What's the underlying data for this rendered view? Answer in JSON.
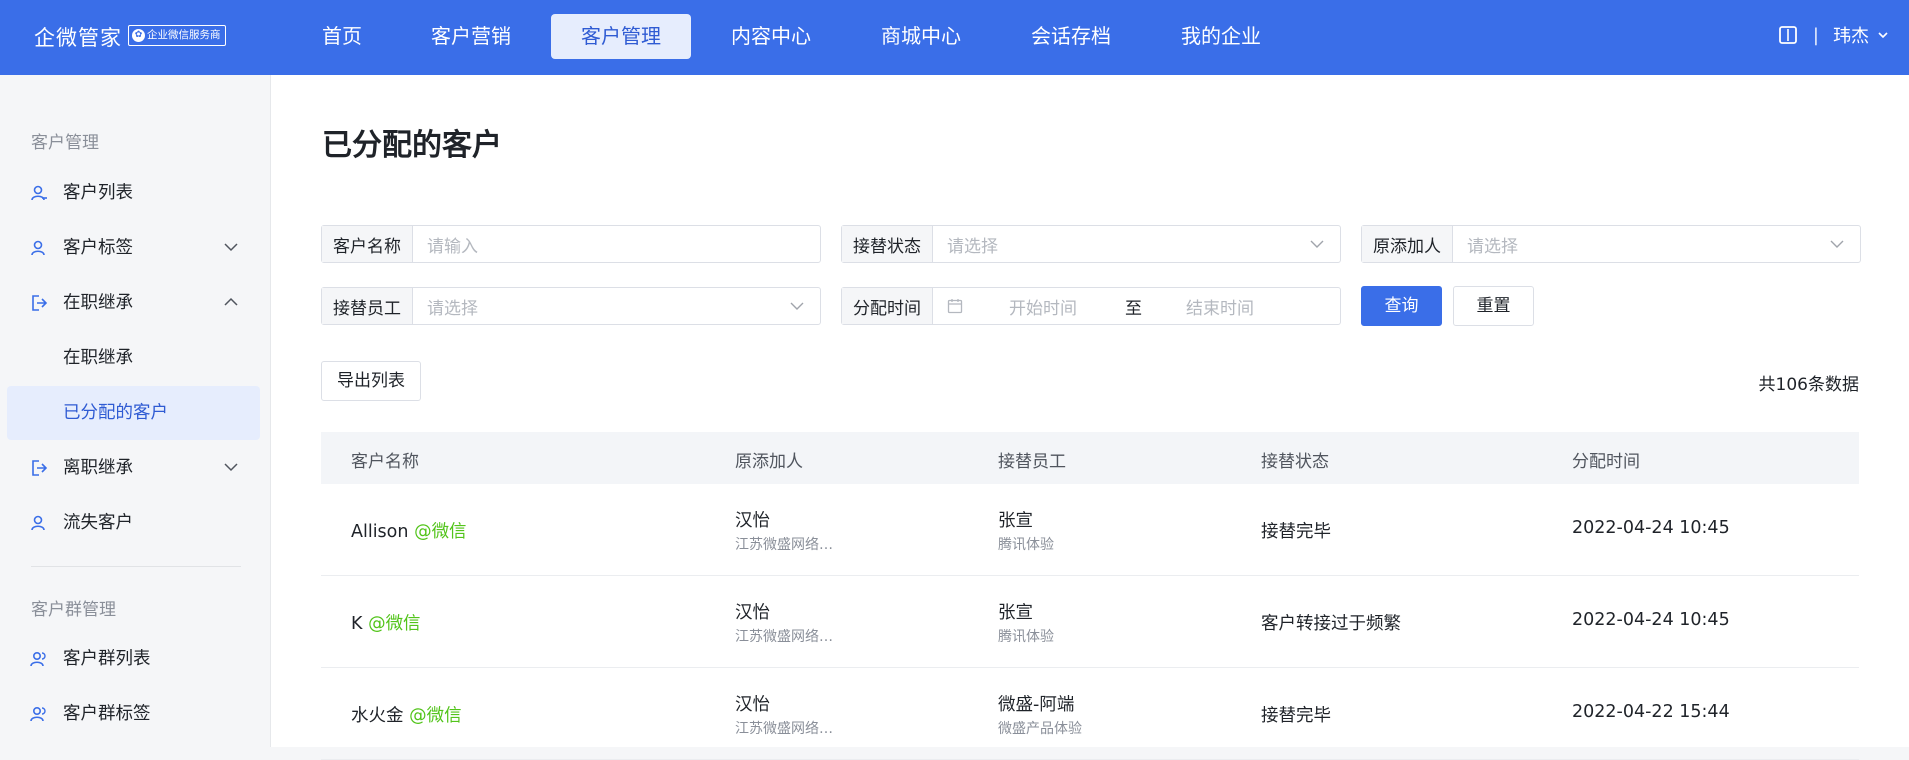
{
  "header": {
    "logo_text": "企微管家",
    "logo_badge": "企业微信服务商",
    "nav": [
      {
        "label": "首页"
      },
      {
        "label": "客户营销"
      },
      {
        "label": "客户管理"
      },
      {
        "label": "内容中心"
      },
      {
        "label": "商城中心"
      },
      {
        "label": "会话存档"
      },
      {
        "label": "我的企业"
      }
    ],
    "active_nav": "客户管理",
    "separator": "|",
    "user_name": "玮杰"
  },
  "sidebar": {
    "group1_title": "客户管理",
    "items": [
      {
        "label": "客户列表",
        "icon": "user-list-icon"
      },
      {
        "label": "客户标签",
        "icon": "user-tag-icon"
      },
      {
        "label": "在职继承",
        "icon": "transfer-in-icon"
      },
      {
        "label": "在职继承"
      },
      {
        "label": "已分配的客户"
      },
      {
        "label": "离职继承",
        "icon": "transfer-out-icon"
      },
      {
        "label": "流失客户",
        "icon": "user-lost-icon"
      }
    ],
    "group2_title": "客户群管理",
    "group2_items": [
      {
        "label": "客户群列表",
        "icon": "group-list-icon"
      },
      {
        "label": "客户群标签",
        "icon": "group-tag-icon"
      }
    ]
  },
  "main": {
    "title": "已分配的客户",
    "filters": {
      "customer_name": {
        "label": "客户名称",
        "placeholder": "请输入"
      },
      "status": {
        "label": "接替状态",
        "placeholder": "请选择"
      },
      "original_adder": {
        "label": "原添加人",
        "placeholder": "请选择"
      },
      "replacement_staff": {
        "label": "接替员工",
        "placeholder": "请选择"
      },
      "assign_time": {
        "label": "分配时间",
        "start_placeholder": "开始时间",
        "to": "至",
        "end_placeholder": "结束时间"
      }
    },
    "query_button": "查询",
    "reset_button": "重置",
    "export_button": "导出列表",
    "total_text": "共106条数据",
    "table": {
      "columns": [
        "客户名称",
        "原添加人",
        "接替员工",
        "接替状态",
        "分配时间"
      ],
      "rows": [
        {
          "name": "Allison",
          "tag": "@微信",
          "adder": "汉怡",
          "adder_sub": "江苏微盛网络…",
          "staff": "张宣",
          "staff_sub": "腾讯体验",
          "status": "接替完毕",
          "time": "2022-04-24 10:45"
        },
        {
          "name": "K",
          "tag": "@微信",
          "adder": "汉怡",
          "adder_sub": "江苏微盛网络…",
          "staff": "张宣",
          "staff_sub": "腾讯体验",
          "status": "客户转接过于频繁",
          "time": "2022-04-24 10:45"
        },
        {
          "name": "水火金",
          "tag": "@微信",
          "adder": "汉怡",
          "adder_sub": "江苏微盛网络…",
          "staff": "微盛-阿端",
          "staff_sub": "微盛产品体验",
          "status": "接替完毕",
          "time": "2022-04-22 15:44"
        }
      ]
    }
  },
  "colors": {
    "primary": "#3a6ee8",
    "wechat_tag": "#52c41a",
    "active_bg": "#e6edfd"
  }
}
